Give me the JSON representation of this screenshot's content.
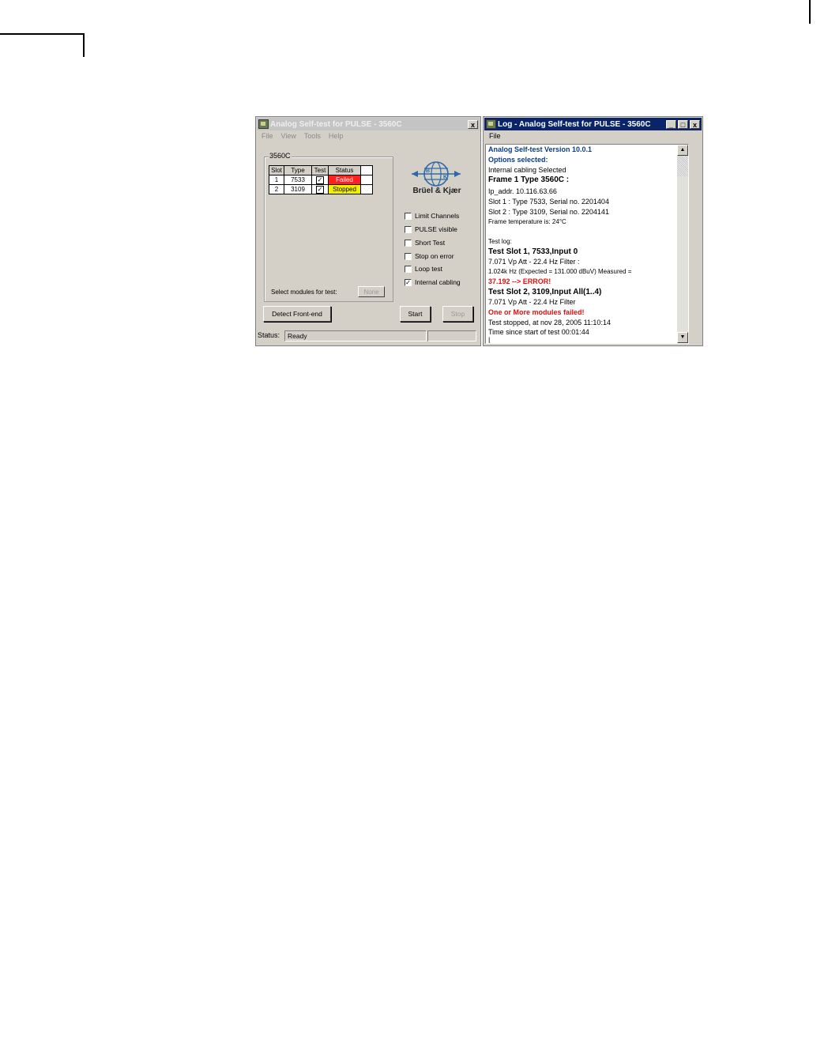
{
  "left_window": {
    "title": "Analog Self-test for PULSE - 3560C",
    "close_label": "x",
    "menu": [
      "File",
      "View",
      "Tools",
      "Help"
    ],
    "group_label": "3560C",
    "table": {
      "headers": [
        "Slot",
        "Type",
        "Test",
        "Status"
      ],
      "rows": [
        {
          "slot": "1",
          "type": "7533",
          "test": "✓",
          "status": "Failed"
        },
        {
          "slot": "2",
          "type": "3109",
          "test": "✓",
          "status": "Stopped"
        }
      ]
    },
    "select_label": "Select modules for test:",
    "none_button": "None",
    "brand": {
      "name": "Brüel & Kjær",
      "letter_b": "B",
      "letter_k": "K"
    },
    "options": [
      {
        "label": "Limit Channels",
        "checked": ""
      },
      {
        "label": "PULSE visible",
        "checked": ""
      },
      {
        "label": "Short Test",
        "checked": ""
      },
      {
        "label": "Stop on error",
        "checked": ""
      },
      {
        "label": "Loop test",
        "checked": ""
      },
      {
        "label": "Internal cabling",
        "checked": "✓"
      }
    ],
    "buttons": {
      "detect": "Detect Front-end",
      "start": "Start",
      "stop": "Stop"
    },
    "status": {
      "label": "Status:",
      "value": "Ready",
      "extra": ""
    }
  },
  "right_window": {
    "title": "Log - Analog Self-test for PULSE - 3560C",
    "menu": [
      "File"
    ],
    "controls": {
      "minimize": "_",
      "maximize": "□",
      "close": "x"
    },
    "log_lines": [
      "Analog Self-test Version 10.0.1",
      "Options selected:",
      "Internal cabling Selected",
      "Frame 1 Type 3560C :",
      "Ip_addr. 10.116.63.66",
      "Slot 1 :  Type 7533, Serial no. 2201404",
      "Slot 2 :  Type 3109, Serial no. 2204141",
      "Frame temperature is: 24°C",
      "Test log:",
      "Test Slot 1, 7533,Input 0",
      "7.071 Vp Att - 22.4 Hz Filter :",
      "1.024k Hz (Expected = 131.000 dBuV) Measured =",
      "37.192 --> ERROR!",
      "Test Slot 2, 3109,Input All(1..4)",
      "7.071 Vp Att - 22.4 Hz Filter",
      "One or More modules failed!",
      "Test stopped, at nov 28, 2005 11:10:14",
      "Time since start of test  00:01:44",
      "|"
    ],
    "scroll_up": "▲",
    "scroll_down": "▼"
  },
  "colors": {
    "failed": "#ff2020",
    "stopped": "#f2f000",
    "active_title": "#0a246a",
    "log_blue": "#0a3c8a",
    "error_red": "#e01010"
  }
}
